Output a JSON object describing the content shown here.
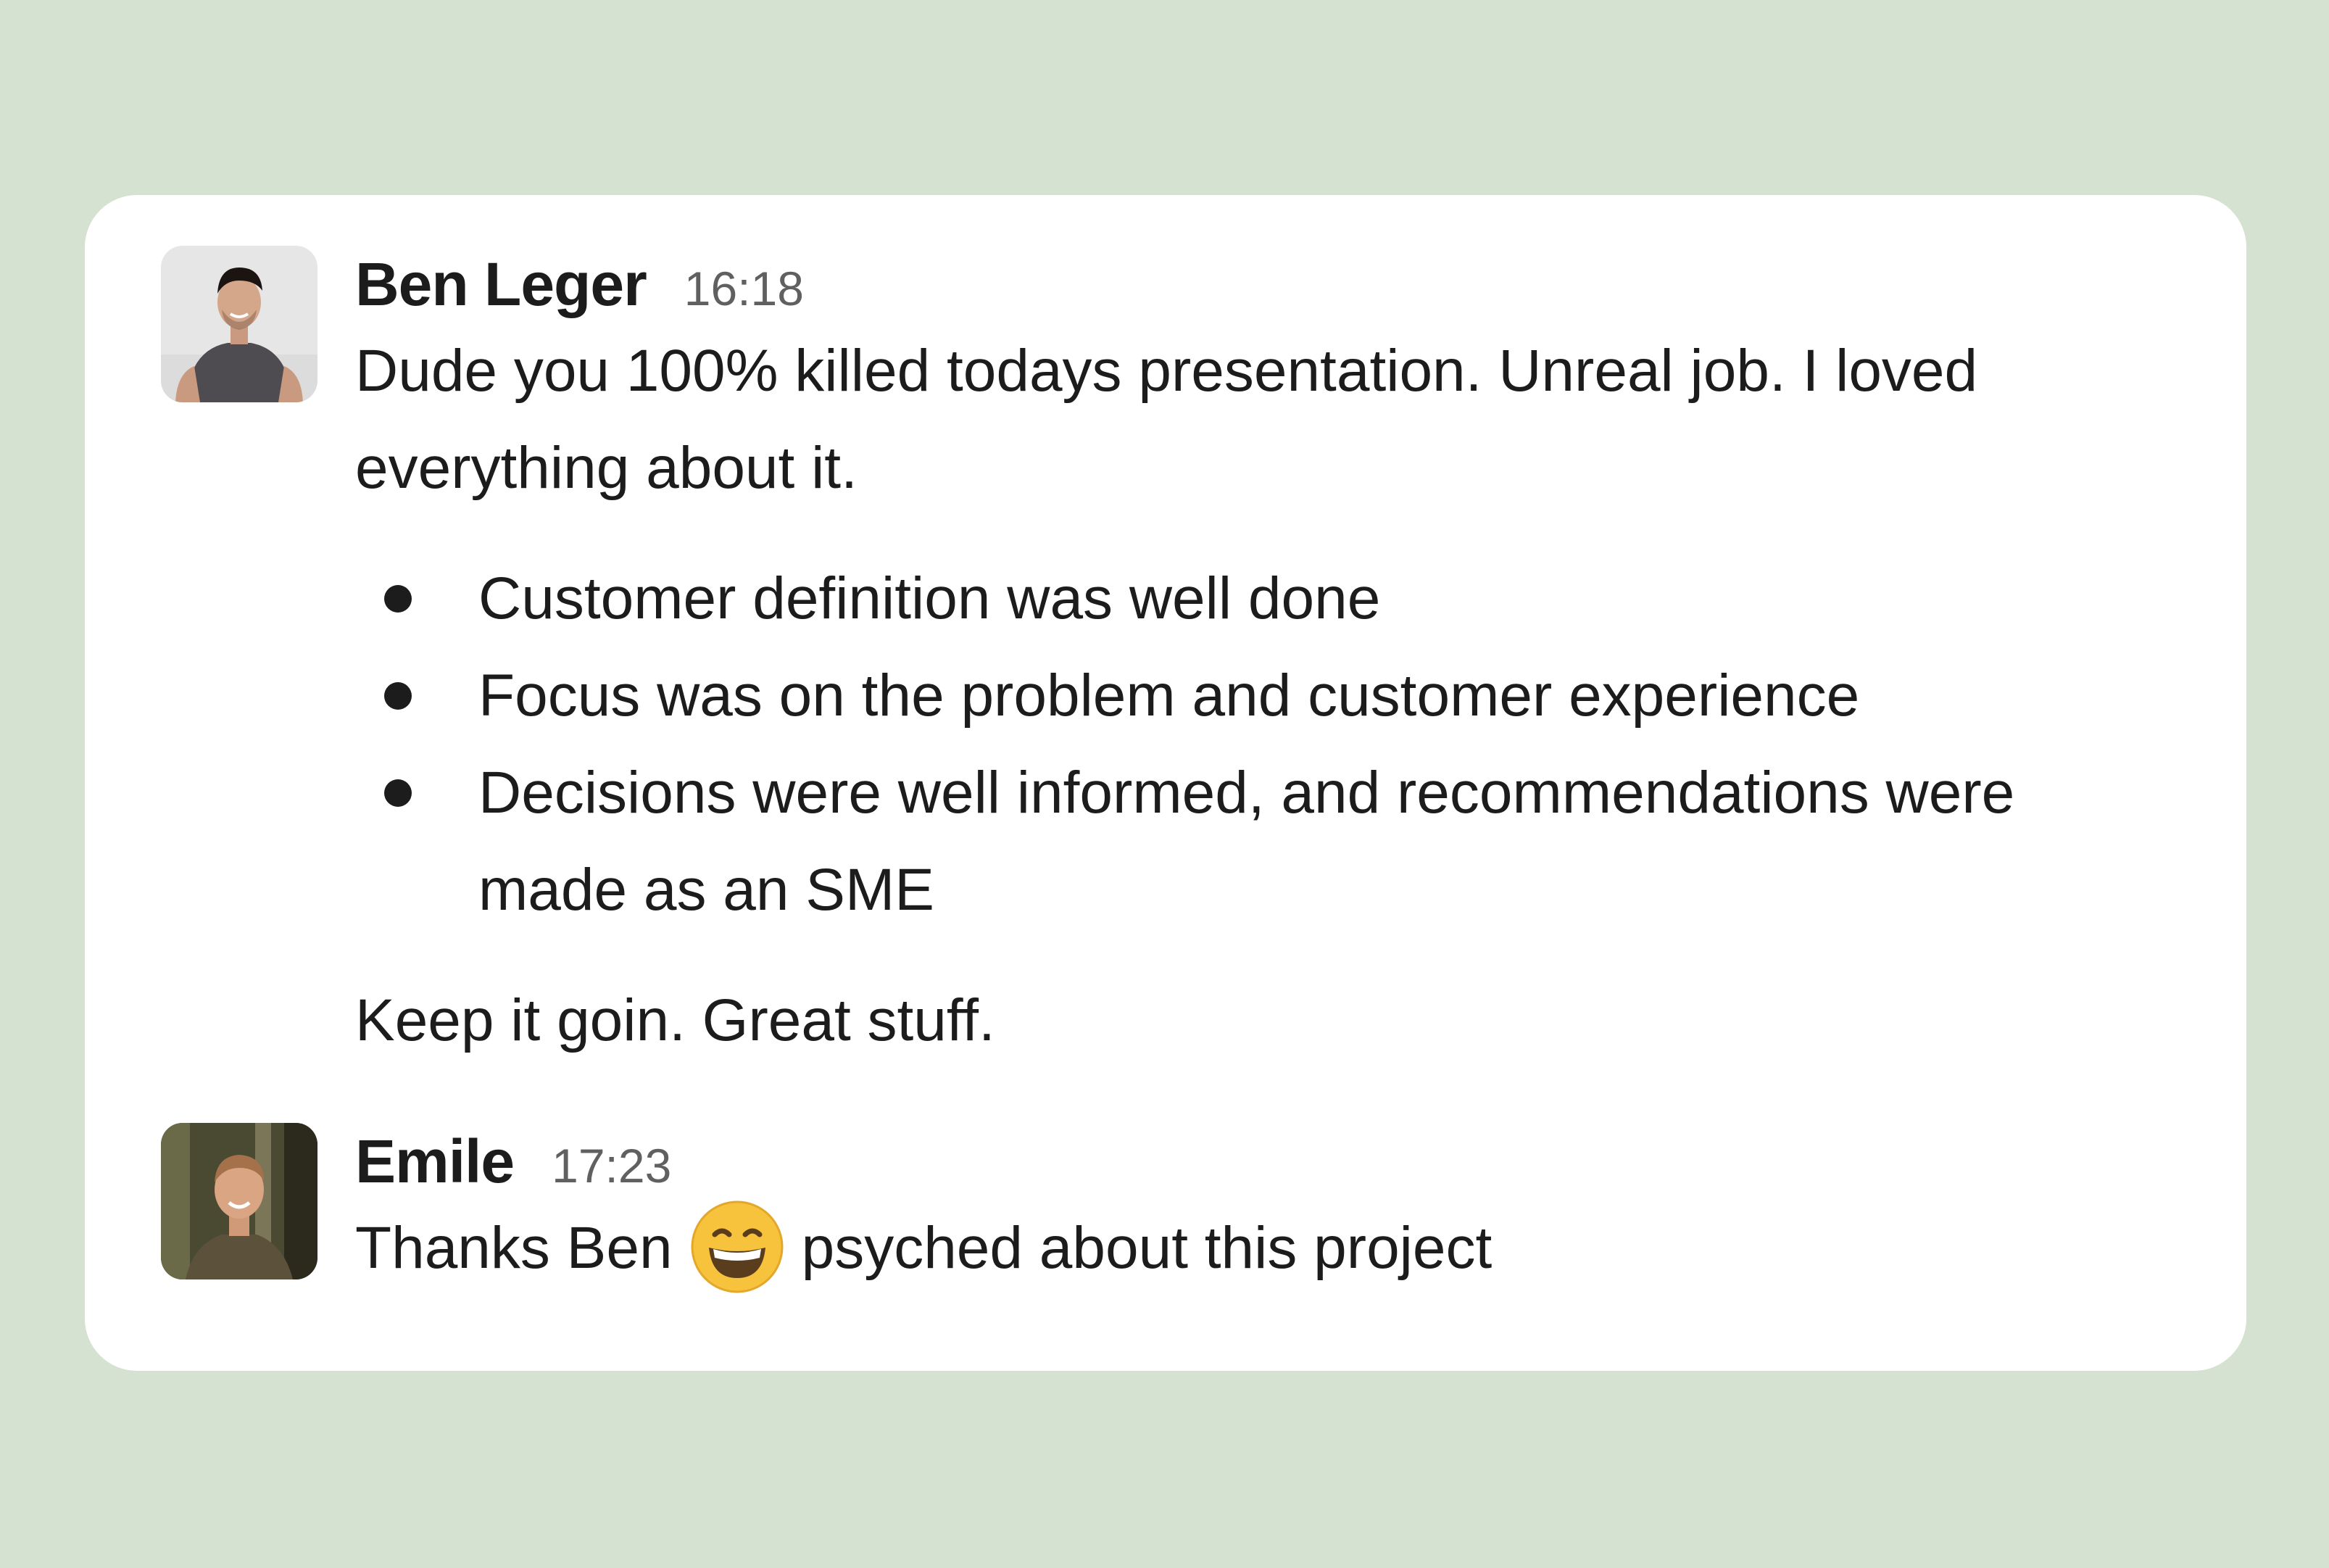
{
  "colors": {
    "page_background": "#d6e2d1",
    "card_background": "#ffffff",
    "text": "#1d1c1d",
    "timestamp": "#616061",
    "emoji_face": "#f7c23c"
  },
  "messages": [
    {
      "sender": "Ben Leger",
      "time": "16:18",
      "avatar": "avatar-photo-icon",
      "intro": "Dude you 100% killed todays presentation. Unreal job. I loved everything about it.",
      "bullets": [
        "Customer definition was well done",
        "Focus was on the problem and customer experience",
        "Decisions were well informed, and recommendations were made as an SME"
      ],
      "outro": "Keep it goin. Great stuff."
    },
    {
      "sender": "Emile",
      "time": "17:23",
      "avatar": "avatar-photo-icon",
      "text_before_emoji": "Thanks Ben",
      "emoji": "grinning-face-icon",
      "text_after_emoji": "psyched about this project"
    }
  ]
}
